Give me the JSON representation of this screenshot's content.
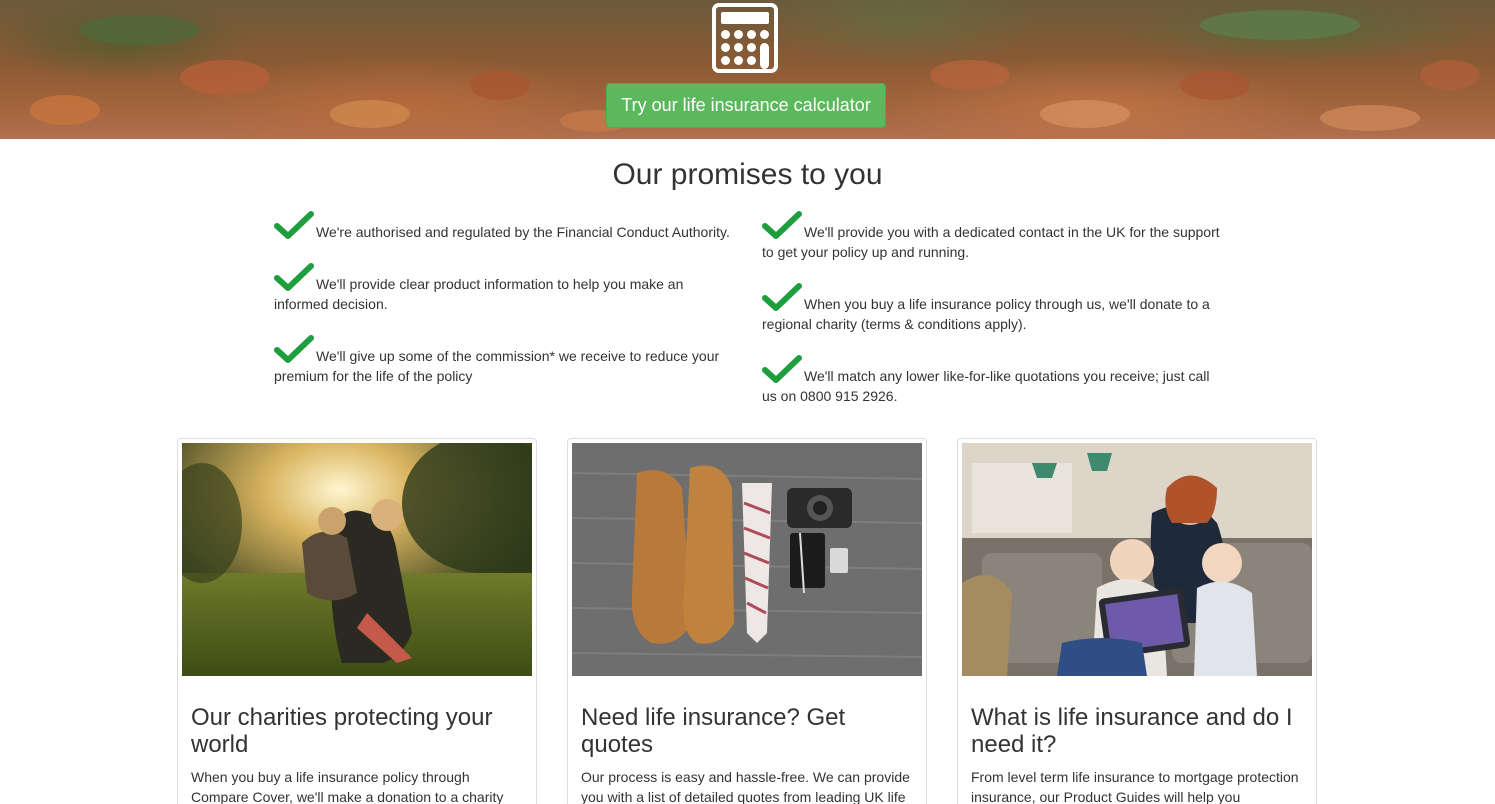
{
  "hero": {
    "calculator_button_label": "Try our life insurance calculator",
    "icon": "calculator-icon"
  },
  "promises": {
    "title": "Our promises to you",
    "left": [
      "We're authorised and regulated by the Financial Conduct Authority.",
      "We'll provide clear product information to help you make an informed decision.",
      "We'll give up some of the commission* we receive to reduce your premium for the life of the policy"
    ],
    "right": [
      "We'll provide you with a dedicated contact in the UK for the support to get your policy up and running.",
      "When you buy a life insurance policy through us, we'll donate to a regional charity (terms & conditions apply).",
      "We'll match any lower like-for-like quotations you receive; just call us on 0800 915 2926."
    ],
    "check_color": "#1e9e3e"
  },
  "cards": [
    {
      "title": "Our charities protecting your world",
      "text": "When you buy a life insurance policy through Compare Cover, we'll make a donation to a charity"
    },
    {
      "title": "Need life insurance? Get quotes",
      "text": "Our process is easy and hassle-free. We can provide you with a list of detailed quotes from leading UK life"
    },
    {
      "title": "What is life insurance and do I need it?",
      "text": "From level term life insurance to mortgage protection insurance, our Product Guides will help you"
    }
  ],
  "colors": {
    "button_green": "#5cb85c",
    "text": "#333333"
  }
}
